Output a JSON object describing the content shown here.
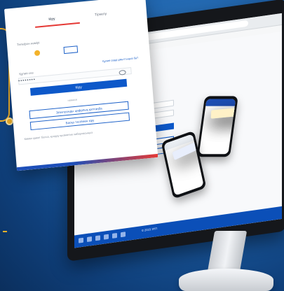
{
  "login_card": {
    "tab_active": "Кіру",
    "tab_inactive": "Тіркелу",
    "phone_label": "Телефон нөмірі",
    "password_label": "Құпия сөз",
    "password_mask": "••••••••",
    "forgot_link": "Құпия сөзді ұмыттыңыз ба?",
    "login_button": "Кіру",
    "divider": "немесе",
    "alt_button_1": "Электронды цифрлық қолтаңба",
    "alt_button_2": "Басқа тәсілмен кіру",
    "help_text": "Көмек қажет болса, қолдау қызметіне хабарласыңыз"
  },
  "monitor": {
    "footer_text": "© 2023 ЭҮП"
  },
  "colors": {
    "accent_blue": "#0d58c9",
    "accent_red": "#e53935",
    "connector_yellow": "#f3b22a"
  }
}
